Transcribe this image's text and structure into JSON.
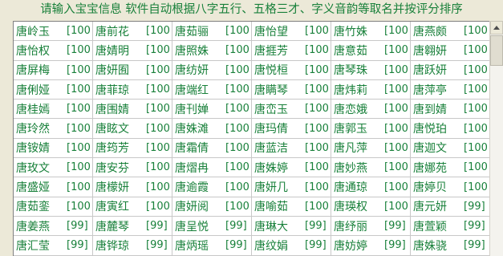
{
  "banner": {
    "text": "请输入宝宝信息 软件自动根据八字五行、五格三才、字义音韵等取名并按评分排序"
  },
  "colors": {
    "text": "#18803a",
    "grid_line": "#c8c8c8",
    "background": "#ece9d8"
  },
  "icons": {
    "scroll_up": "up-arrow-icon"
  },
  "grid": {
    "rows": [
      [
        {
          "name": "唐岭玉",
          "score": "[100"
        },
        {
          "name": "唐前花",
          "score": "[100"
        },
        {
          "name": "唐茹骊",
          "score": "[100"
        },
        {
          "name": "唐怡望",
          "score": "[100"
        },
        {
          "name": "唐竹姝",
          "score": "[100"
        },
        {
          "name": "唐燕颇",
          "score": "[100"
        }
      ],
      [
        {
          "name": "唐怡权",
          "score": "[100"
        },
        {
          "name": "唐婧明",
          "score": "[100"
        },
        {
          "name": "唐照姝",
          "score": "[100"
        },
        {
          "name": "唐捱芳",
          "score": "[100"
        },
        {
          "name": "唐意茹",
          "score": "[100"
        },
        {
          "name": "唐翱妍",
          "score": "[100"
        }
      ],
      [
        {
          "name": "唐屏梅",
          "score": "[100"
        },
        {
          "name": "唐妍囿",
          "score": "[100"
        },
        {
          "name": "唐纺妍",
          "score": "[100"
        },
        {
          "name": "唐悦桓",
          "score": "[100"
        },
        {
          "name": "唐琴珠",
          "score": "[100"
        },
        {
          "name": "唐跃妍",
          "score": "[100"
        }
      ],
      [
        {
          "name": "唐俐娅",
          "score": "[100"
        },
        {
          "name": "唐菲琼",
          "score": "[100"
        },
        {
          "name": "唐端红",
          "score": "[100"
        },
        {
          "name": "唐瞒琴",
          "score": "[100"
        },
        {
          "name": "唐炜莉",
          "score": "[100"
        },
        {
          "name": "唐萍亭",
          "score": "[100"
        }
      ],
      [
        {
          "name": "唐桂嫣",
          "score": "[100"
        },
        {
          "name": "唐围婧",
          "score": "[100"
        },
        {
          "name": "唐刊婵",
          "score": "[100"
        },
        {
          "name": "唐峦玉",
          "score": "[100"
        },
        {
          "name": "唐恋娥",
          "score": "[100"
        },
        {
          "name": "唐到婧",
          "score": "[100"
        }
      ],
      [
        {
          "name": "唐玲然",
          "score": "[100"
        },
        {
          "name": "唐眩文",
          "score": "[100"
        },
        {
          "name": "唐姝滩",
          "score": "[100"
        },
        {
          "name": "唐玛倩",
          "score": "[100"
        },
        {
          "name": "唐郭玉",
          "score": "[100"
        },
        {
          "name": "唐悦珀",
          "score": "[100"
        }
      ],
      [
        {
          "name": "唐铵婧",
          "score": "[100"
        },
        {
          "name": "唐筠芳",
          "score": "[100"
        },
        {
          "name": "唐霜倩",
          "score": "[100"
        },
        {
          "name": "唐蓝洁",
          "score": "[100"
        },
        {
          "name": "唐凡萍",
          "score": "[100"
        },
        {
          "name": "唐迦文",
          "score": "[100"
        }
      ],
      [
        {
          "name": "唐玫文",
          "score": "[100"
        },
        {
          "name": "唐安芬",
          "score": "[100"
        },
        {
          "name": "唐熠冉",
          "score": "[100"
        },
        {
          "name": "唐姝婷",
          "score": "[100"
        },
        {
          "name": "唐妙燕",
          "score": "[100"
        },
        {
          "name": "唐娜苑",
          "score": "[100"
        }
      ],
      [
        {
          "name": "唐盛娅",
          "score": "[100"
        },
        {
          "name": "唐檬妍",
          "score": "[100"
        },
        {
          "name": "唐逾霞",
          "score": "[100"
        },
        {
          "name": "唐妍几",
          "score": "[100"
        },
        {
          "name": "唐通琼",
          "score": "[100"
        },
        {
          "name": "唐婷贝",
          "score": "[100"
        }
      ],
      [
        {
          "name": "唐茹銮",
          "score": "[100"
        },
        {
          "name": "唐寅红",
          "score": "[100"
        },
        {
          "name": "唐妍阅",
          "score": "[100"
        },
        {
          "name": "唐喻茹",
          "score": "[100"
        },
        {
          "name": "唐瑛权",
          "score": "[100"
        },
        {
          "name": "唐元妍",
          "score": "[99]"
        }
      ],
      [
        {
          "name": "唐姜燕",
          "score": "[99]"
        },
        {
          "name": "唐麓琴",
          "score": "[99]"
        },
        {
          "name": "唐呈悦",
          "score": "[99]"
        },
        {
          "name": "唐琳大",
          "score": "[99]"
        },
        {
          "name": "唐纾丽",
          "score": "[99]"
        },
        {
          "name": "唐萱颖",
          "score": "[99]"
        }
      ],
      [
        {
          "name": "唐汇莹",
          "score": "[99]"
        },
        {
          "name": "唐铧琼",
          "score": "[99]"
        },
        {
          "name": "唐炳瑶",
          "score": "[99]"
        },
        {
          "name": "唐纹娟",
          "score": "[99]"
        },
        {
          "name": "唐妨婷",
          "score": "[99]"
        },
        {
          "name": "唐姝骁",
          "score": "[99]"
        }
      ]
    ]
  }
}
